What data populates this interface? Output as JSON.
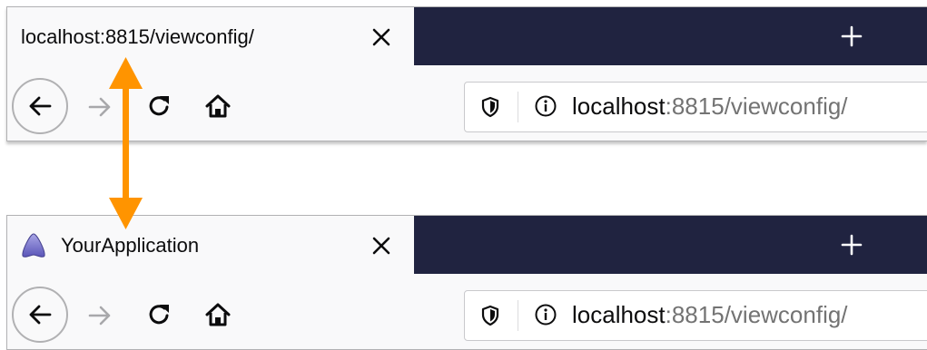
{
  "top_browser": {
    "tab_title": "localhost:8815/viewconfig/",
    "tab_close_icon": "close-icon",
    "new_tab_icon": "plus-icon",
    "url_host": "localhost",
    "url_rest": ":8815/viewconfig/"
  },
  "bottom_browser": {
    "tab_title": "YourApplication",
    "favicon": "app-favicon",
    "tab_close_icon": "close-icon",
    "new_tab_icon": "plus-icon",
    "url_host": "localhost",
    "url_rest": ":8815/viewconfig/"
  },
  "annotation": {
    "arrow": "double-headed-arrow",
    "color": "#ff9400"
  },
  "colors": {
    "tabstrip_dark": "#202340",
    "toolbar": "#f9f9fa",
    "url_rest": "#737373"
  }
}
